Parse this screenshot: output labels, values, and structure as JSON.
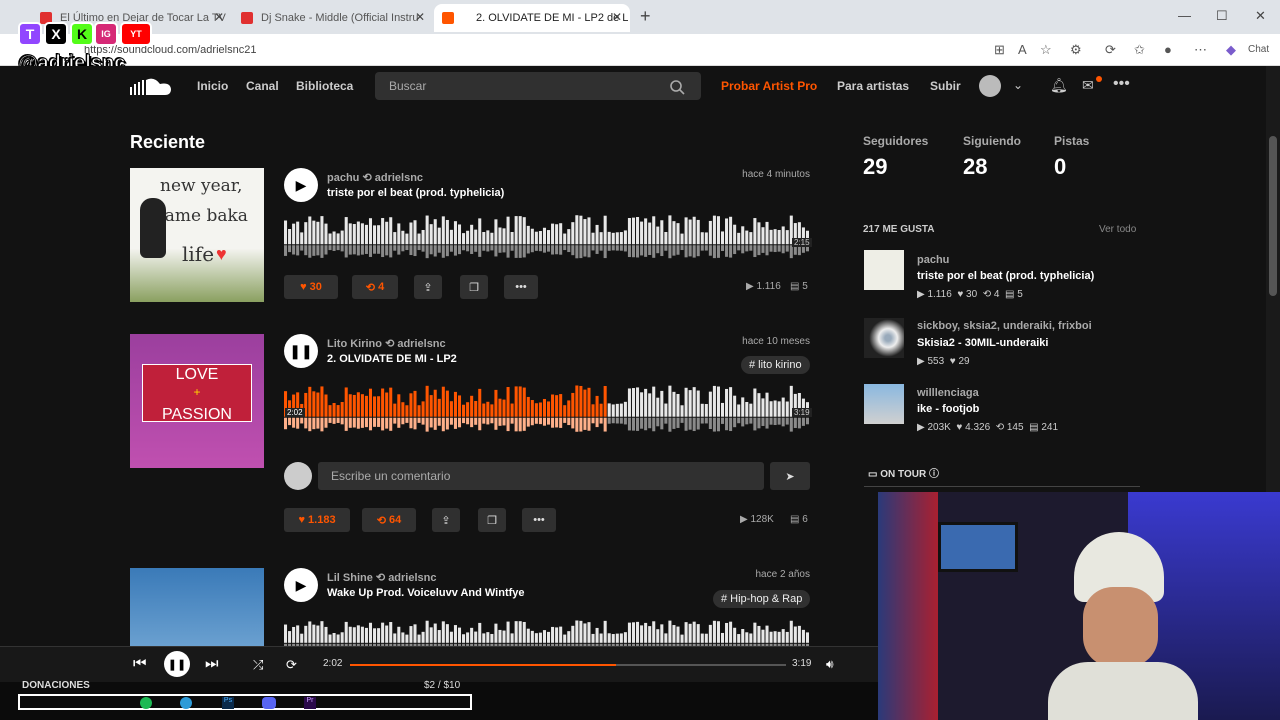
{
  "browser": {
    "tabs": [
      {
        "label": "El Último en Dejar de Tocar La TV",
        "active": false
      },
      {
        "label": "Dj Snake - Middle (Official Instru",
        "active": false
      },
      {
        "label": "2. OLVIDATE DE MI - LP2 de L",
        "active": true
      }
    ],
    "new_tab": "+",
    "url": "https://soundcloud.com/adrielsnc21",
    "chat_label": "Chat"
  },
  "overlay": {
    "handle": "@adrielsnc",
    "socials": [
      "T",
      "X",
      "K",
      "IG",
      "YT"
    ]
  },
  "nav": {
    "links": [
      "Inicio",
      "Canal",
      "Biblioteca"
    ],
    "search_placeholder": "Buscar",
    "artist_pro": "Probar Artist Pro",
    "para_artistas": "Para artistas",
    "subir": "Subir"
  },
  "feed": {
    "heading": "Reciente",
    "tracks": [
      {
        "artist": "pachu",
        "repost_by": "adrielsnc",
        "title": "triste por el beat (prod. typhelicia)",
        "time": "hace 4 minutos",
        "duration": "2:15",
        "likes": "30",
        "reposts": "4",
        "plays": "1.116",
        "comments": "5",
        "art_text": [
          "new year,",
          "same baka",
          "life"
        ],
        "playing": false
      },
      {
        "artist": "Lito Kirino",
        "repost_by": "adrielsnc",
        "title": "2. OLVIDATE DE MI - LP2",
        "time": "hace 10 meses",
        "tag": "# lito kirino",
        "duration": "3:19",
        "position": "2:02",
        "likes": "1.183",
        "reposts": "64",
        "plays": "128K",
        "comments": "6",
        "art_text": [
          "LOVE",
          "+",
          "PASSION"
        ],
        "comment_placeholder": "Escribe un comentario",
        "progress": 0.61,
        "playing": true
      },
      {
        "artist": "Lil Shine",
        "repost_by": "adrielsnc",
        "title": "Wake Up Prod. Voiceluvv And Wintfye",
        "time": "hace 2 años",
        "tag": "# Hip-hop & Rap",
        "playing": false
      }
    ]
  },
  "sidebar": {
    "stats": [
      {
        "label": "Seguidores",
        "value": "29"
      },
      {
        "label": "Siguiendo",
        "value": "28"
      },
      {
        "label": "Pistas",
        "value": "0"
      }
    ],
    "likes_heading": "217 ME GUSTA",
    "ver_todo": "Ver todo",
    "likes": [
      {
        "user": "pachu",
        "title": "triste por el beat (prod. typhelicia)",
        "plays": "1.116",
        "likes": "30",
        "reposts": "4",
        "comments": "5"
      },
      {
        "user": "sickboy, sksia2, underaiki, frixboi",
        "title": "Skisia2 - 30MIL-underaiki",
        "plays": "553",
        "likes": "29"
      },
      {
        "user": "willlenciaga",
        "title": "ike - footjob",
        "plays": "203K",
        "likes": "4.326",
        "reposts": "145",
        "comments": "241"
      }
    ],
    "on_tour": "ON TOUR"
  },
  "player": {
    "current": "2:02",
    "total": "3:19",
    "progress": 0.61
  },
  "donation_bar": {
    "label": "DONACIONES",
    "amount": "$2 / $10"
  },
  "colors": {
    "accent": "#ff5500",
    "bg": "#121212"
  }
}
